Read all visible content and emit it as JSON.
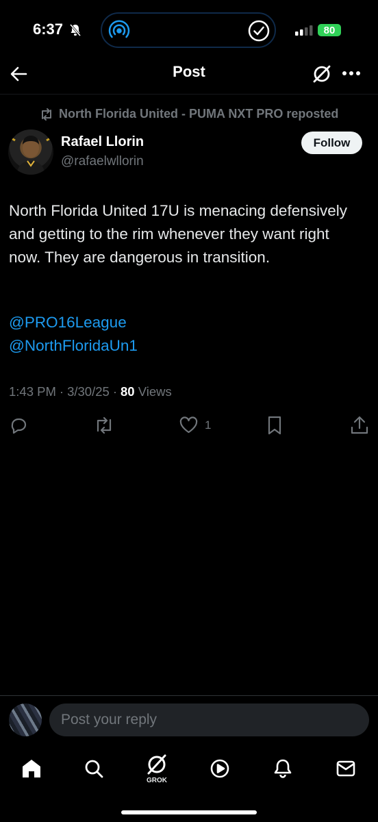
{
  "status_bar": {
    "time": "6:37",
    "battery": "80"
  },
  "header": {
    "title": "Post"
  },
  "repost": {
    "text": "North Florida United - PUMA NXT PRO reposted"
  },
  "author": {
    "name": "Rafael Llorin",
    "handle": "@rafaelwllorin"
  },
  "follow_label": "Follow",
  "post": {
    "text": "North Florida United 17U is menacing defensively and getting to the rim whenever they want right now. They are dangerous in transition.",
    "mentions": [
      "@PRO16League",
      "@NorthFloridaUn1"
    ]
  },
  "meta": {
    "time": "1:43 PM",
    "date": "3/30/25",
    "views_count": "80",
    "views_label": "Views"
  },
  "actions": {
    "like_count": "1"
  },
  "reply": {
    "placeholder": "Post your reply"
  },
  "tabs": {
    "grok_label": "GROK"
  },
  "colors": {
    "accent": "#1d9bf0",
    "muted": "#71767b",
    "background": "#000000",
    "battery": "#30d158"
  },
  "icons": [
    "bell-slash-icon",
    "airdrop-icon",
    "checkmark-circle-icon",
    "signal-icon",
    "back-arrow-icon",
    "grok-icon",
    "more-icon",
    "repost-icon",
    "reply-icon",
    "like-icon",
    "bookmark-icon",
    "share-icon",
    "home-icon",
    "search-icon",
    "video-icon",
    "notifications-icon",
    "messages-icon"
  ]
}
